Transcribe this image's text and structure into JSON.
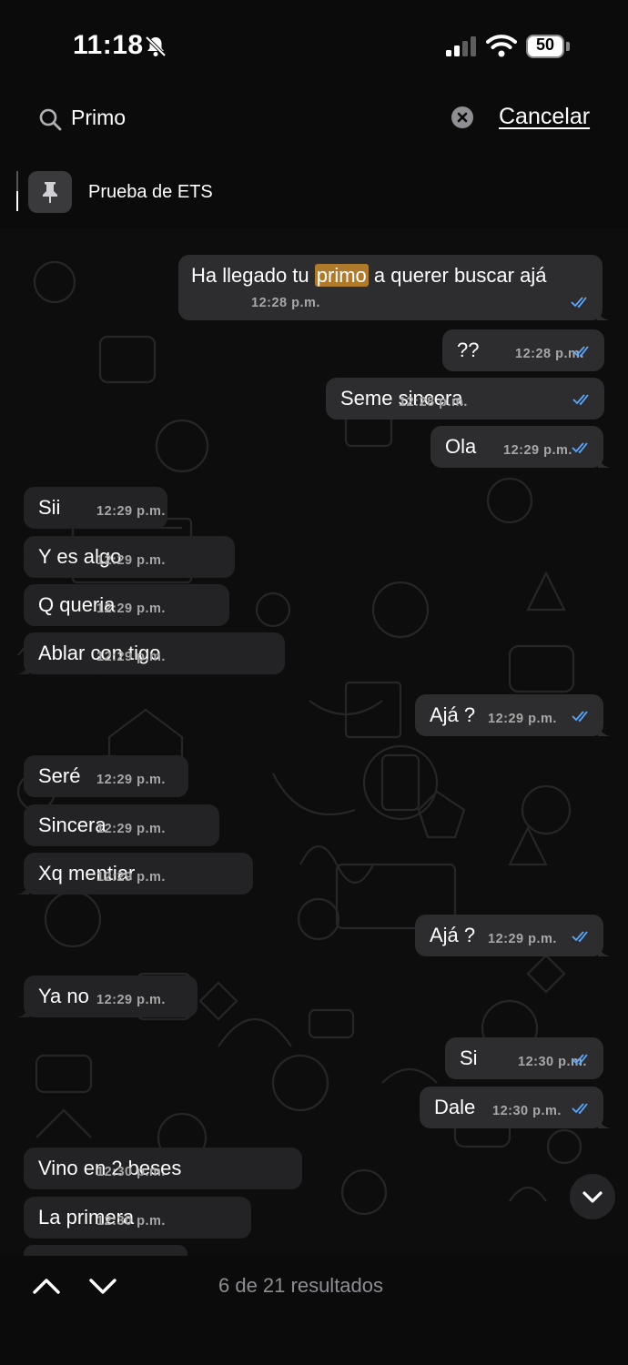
{
  "status_bar": {
    "time": "11:18",
    "battery": "50"
  },
  "search": {
    "query": "Primo",
    "cancel_label": "Cancelar"
  },
  "pinned": {
    "label": "Prueba de ETS"
  },
  "messages": [
    {
      "dir": "out",
      "pre": "Ha llegado tu ",
      "highlight": "primo",
      "post": " a querer buscar ajá",
      "time": "12:28 p.m."
    },
    {
      "dir": "out",
      "text": "??",
      "time": "12:28 p.m."
    },
    {
      "dir": "out",
      "text": "Seme sincera",
      "time": "12:28 p.m."
    },
    {
      "dir": "out",
      "text": "Ola",
      "time": "12:29 p.m."
    },
    {
      "dir": "in",
      "text": "Sii",
      "time": "12:29 p.m."
    },
    {
      "dir": "in",
      "text": "Y es algo",
      "time": "12:29 p.m."
    },
    {
      "dir": "in",
      "text": "Q queria",
      "time": "12:29 p.m."
    },
    {
      "dir": "in",
      "text": "Ablar con tigo",
      "time": "12:29 p.m."
    },
    {
      "dir": "out",
      "text": "Ajá ?",
      "time": "12:29 p.m."
    },
    {
      "dir": "in",
      "text": "Seré",
      "time": "12:29 p.m."
    },
    {
      "dir": "in",
      "text": "Sincera",
      "time": "12:29 p.m."
    },
    {
      "dir": "in",
      "text": "Xq mentiar",
      "time": "12:29 p.m."
    },
    {
      "dir": "out",
      "text": "Ajá ?",
      "time": "12:29 p.m."
    },
    {
      "dir": "in",
      "text": "Ya no",
      "time": "12:29 p.m."
    },
    {
      "dir": "out",
      "text": "Si",
      "time": "12:30 p.m."
    },
    {
      "dir": "out",
      "text": "Dale",
      "time": "12:30 p.m."
    },
    {
      "dir": "in",
      "text": "Vino en 2 beses",
      "time": "12:30 p.m."
    },
    {
      "dir": "in",
      "text": "La primera",
      "time": "12:30 p.m."
    }
  ],
  "results": {
    "label": "6 de 21 resultados"
  },
  "colors": {
    "highlight": "#b07a2c",
    "ticks": "#5aa8ff"
  },
  "icons": [
    "bell-slash-icon",
    "signal-icon",
    "wifi-icon",
    "battery-icon",
    "search-icon",
    "clear-icon",
    "pin-icon",
    "double-check-icon",
    "chevron-down-icon",
    "chevron-up-icon"
  ]
}
